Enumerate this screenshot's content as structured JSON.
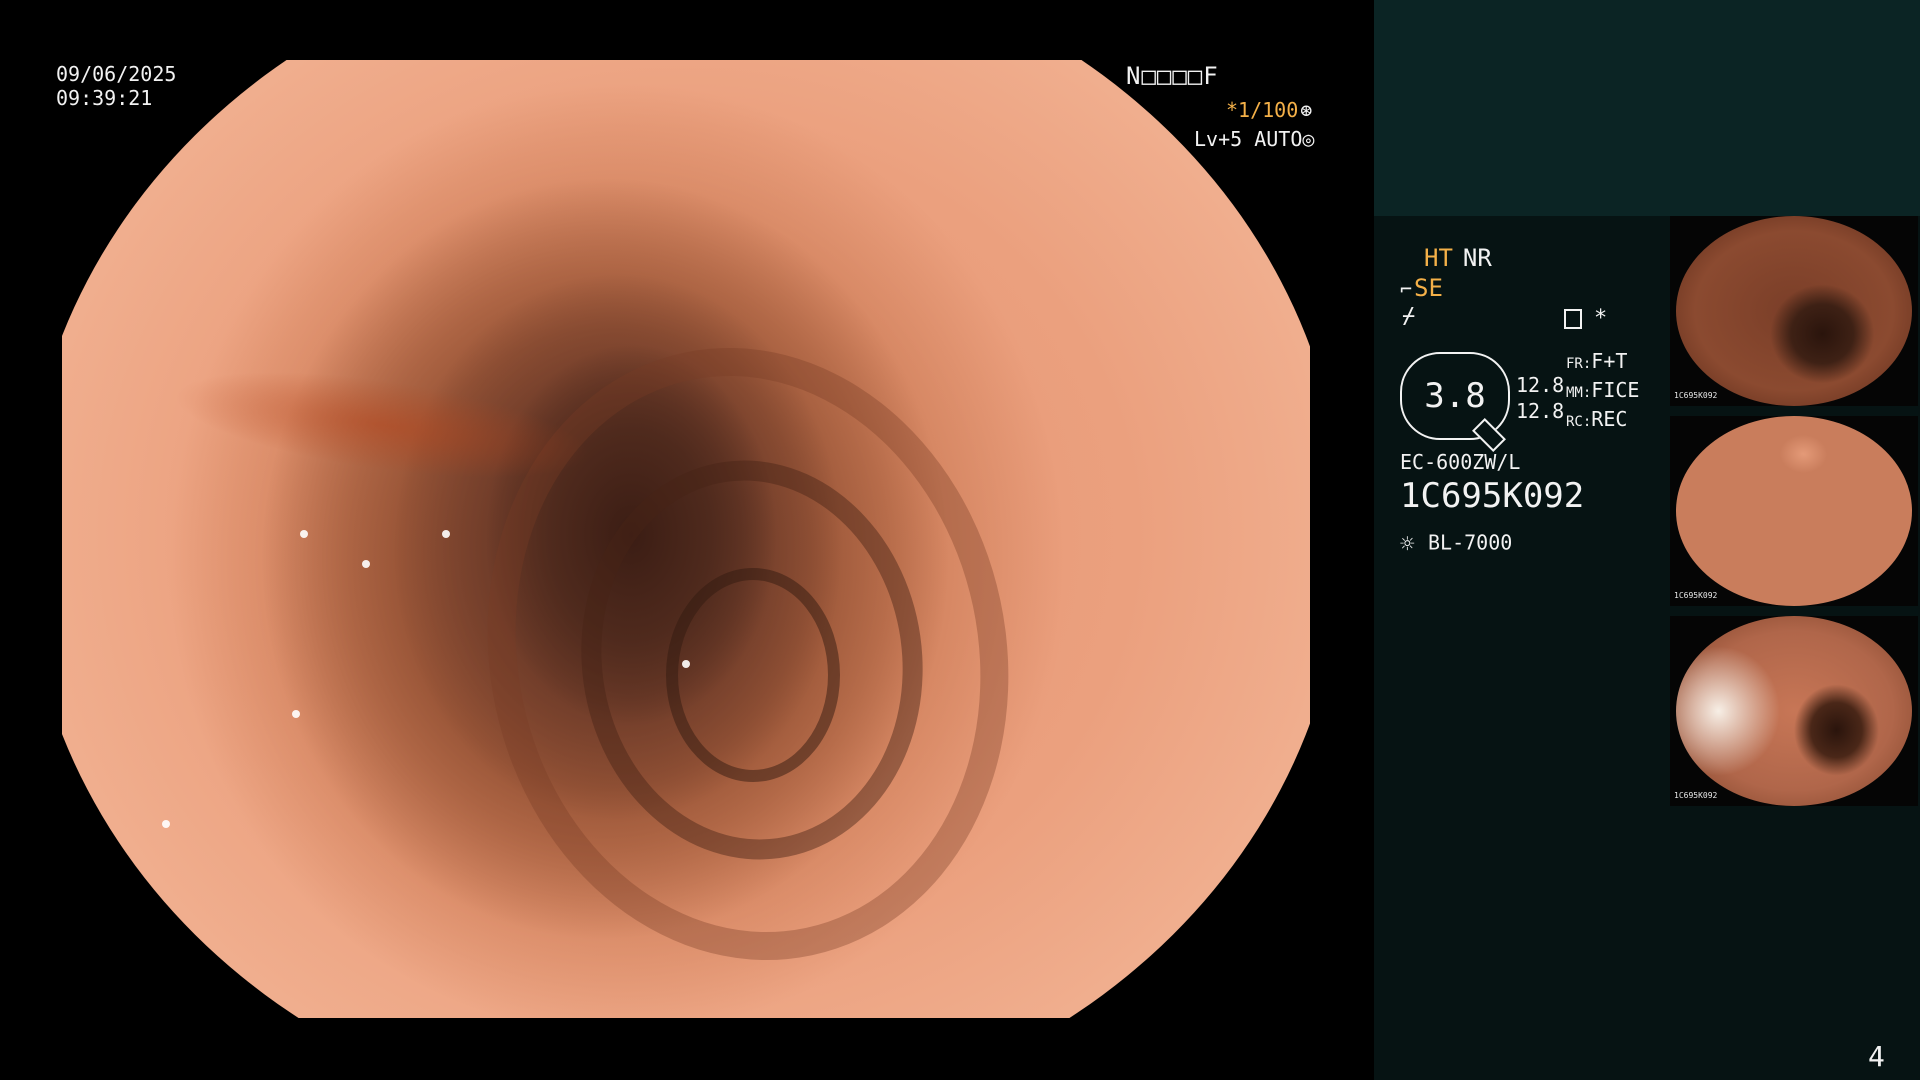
{
  "osd": {
    "date": "09/06/2025",
    "time": "09:39:21",
    "status_code": "N□□□□F",
    "shutter_prefix": "*1/100",
    "shutter_icon": "⊛",
    "level": "Lv+5 AUTO",
    "level_icon": "◎"
  },
  "panel": {
    "ht": "HT",
    "nr": "NR",
    "se_icon": "⌐",
    "se": "SE",
    "sharp_icon": "⌿",
    "mode_star": "*",
    "zoom_value": "3.8",
    "nums": [
      "12.8",
      "12.8"
    ],
    "modes": [
      {
        "key": "FR:",
        "value": "F+T"
      },
      {
        "key": "MM:",
        "value": "FICE"
      },
      {
        "key": "RC:",
        "value": "REC"
      }
    ],
    "scope_model": "EC-600ZW/L",
    "scope_serial": "1C695K092",
    "light_icon": "☼",
    "light_source": "BL-7000"
  },
  "thumbnails": [
    {
      "label": "1C695K092"
    },
    {
      "label": "1C695K092"
    },
    {
      "label": "1C695K092"
    }
  ],
  "page_number": "4",
  "colors": {
    "accent_amber": "#f4b048",
    "panel_top": "#0b2424",
    "panel_main": "#061313"
  }
}
